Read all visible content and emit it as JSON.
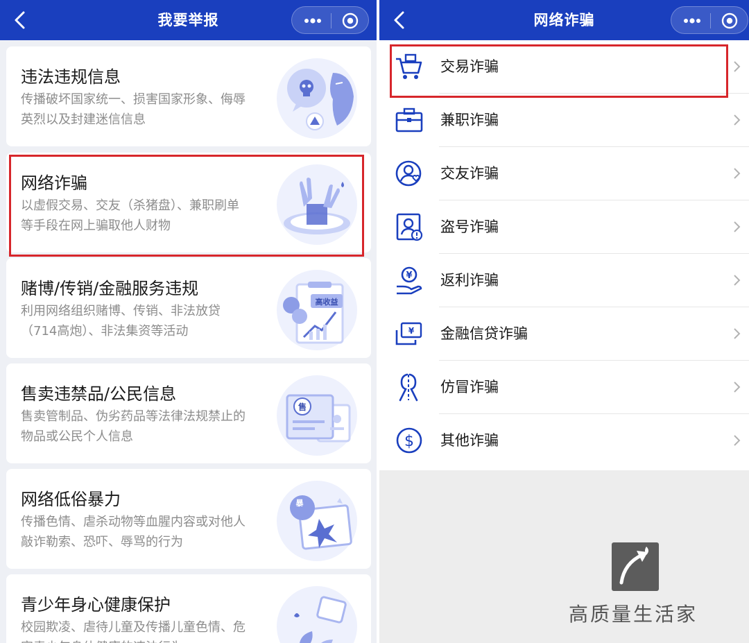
{
  "left": {
    "title": "我要举报",
    "cards": [
      {
        "title": "违法违规信息",
        "desc": "传播破坏国家统一、损害国家形象、侮辱英烈以及封建迷信信息"
      },
      {
        "title": "网络诈骗",
        "desc": "以虚假交易、交友（杀猪盘）、兼职刷单等手段在网上骗取他人财物"
      },
      {
        "title": "赌博/传销/金融服务违规",
        "desc": "利用网络组织赌博、传销、非法放贷（714高炮）、非法集资等活动"
      },
      {
        "title": "售卖违禁品/公民信息",
        "desc": "售卖管制品、伪劣药品等法律法规禁止的物品或公民个人信息"
      },
      {
        "title": "网络低俗暴力",
        "desc": "传播色情、虐杀动物等血腥内容或对他人敲诈勒索、恐吓、辱骂的行为"
      },
      {
        "title": "青少年身心健康保护",
        "desc": "校园欺凌、虐待儿童及传播儿童色情、危害青少年身体健康的违法行为"
      }
    ],
    "illus_text": {
      "gao": "高收益",
      "shou": "售",
      "bao": "暴"
    }
  },
  "right": {
    "title": "网络诈骗",
    "items": [
      {
        "label": "交易诈骗",
        "icon": "shopping-cart-icon"
      },
      {
        "label": "兼职诈骗",
        "icon": "briefcase-icon"
      },
      {
        "label": "交友诈骗",
        "icon": "friend-heart-icon"
      },
      {
        "label": "盗号诈骗",
        "icon": "account-theft-icon"
      },
      {
        "label": "返利诈骗",
        "icon": "yuan-hand-icon"
      },
      {
        "label": "金融信贷诈骗",
        "icon": "yuan-card-icon"
      },
      {
        "label": "仿冒诈骗",
        "icon": "impersonate-icon"
      },
      {
        "label": "其他诈骗",
        "icon": "dollar-circle-icon"
      }
    ]
  },
  "watermark": {
    "text": "高质量生活家"
  },
  "colors": {
    "navbar": "#1a3fbe",
    "highlight": "#d7262b",
    "icon_blue": "#1a3fbe",
    "illus_blue": "#a9b6f0"
  }
}
